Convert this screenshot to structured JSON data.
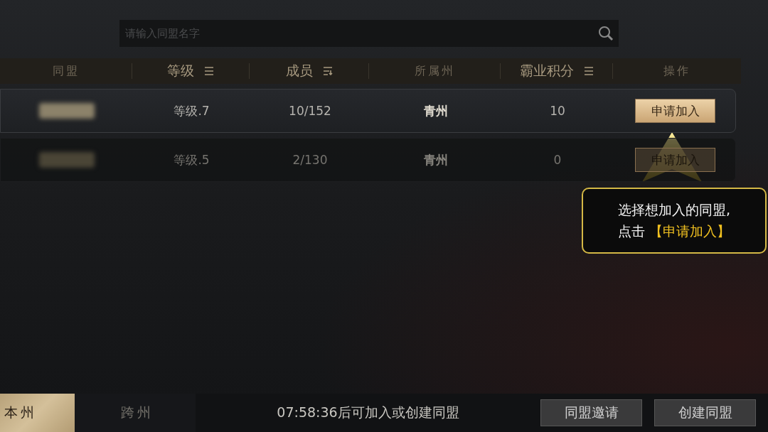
{
  "search": {
    "placeholder": "请输入同盟名字"
  },
  "columns": [
    {
      "label": "同盟",
      "kind": "plain"
    },
    {
      "label": "等级",
      "kind": "lines"
    },
    {
      "label": "成员",
      "kind": "order"
    },
    {
      "label": "所属州",
      "kind": "plain"
    },
    {
      "label": "霸业积分",
      "kind": "lines"
    },
    {
      "label": "操作",
      "kind": "plain"
    }
  ],
  "rows": [
    {
      "level": "等级.7",
      "members": "10/152",
      "region": "青州",
      "score": "10",
      "action": "申请加入",
      "dimmed": false
    },
    {
      "level": "等级.5",
      "members": "2/130",
      "region": "青州",
      "score": "0",
      "action": "申请加入",
      "dimmed": true
    }
  ],
  "tooltip": {
    "line_1": "选择想加入的同盟,",
    "line_2_prefix": "点击",
    "line_2_highlight": "【申请加入】"
  },
  "tabs": [
    {
      "label": "本州",
      "selected": true
    },
    {
      "label": "跨州",
      "selected": false
    }
  ],
  "status": "07:58:36后可加入或创建同盟",
  "buttons": [
    "同盟邀请",
    "创建同盟"
  ]
}
